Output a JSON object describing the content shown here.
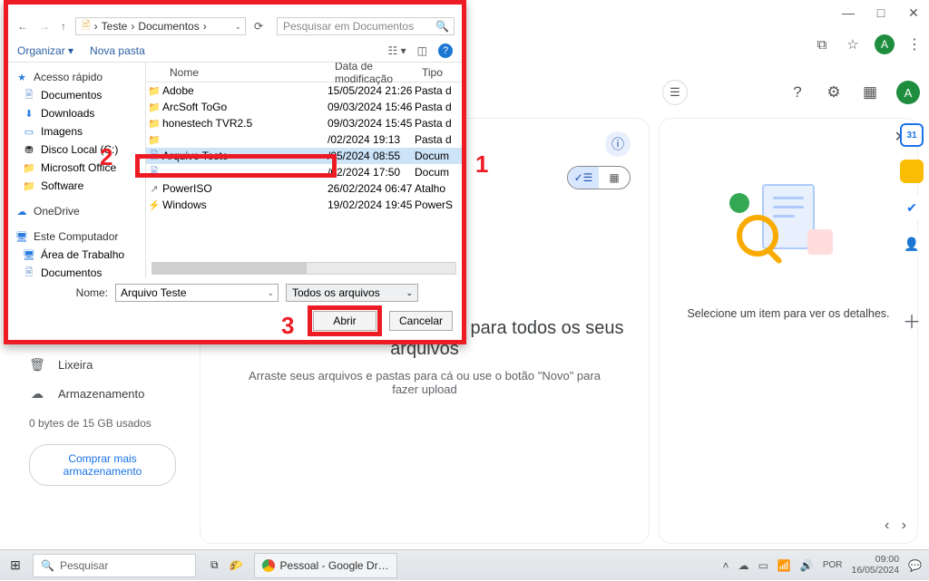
{
  "browser": {
    "avatar_initial": "A"
  },
  "drive": {
    "header_avatar": "A",
    "main_title": "Este é o Google Drive, o local para todos os seus arquivos",
    "main_sub": "Arraste seus arquivos e pastas para cá ou use o botão \"Novo\" para fazer upload",
    "detail_text": "Selecione um item para ver os detalhes.",
    "side": {
      "trash": "Lixeira",
      "storage": "Armazenamento",
      "usage": "0 bytes de 15 GB usados",
      "buy": "Comprar mais armazenamento"
    }
  },
  "dialog": {
    "path": {
      "root": "Teste",
      "folder": "Documentos"
    },
    "search_placeholder": "Pesquisar em Documentos",
    "toolbar": {
      "organize": "Organizar",
      "newfolder": "Nova pasta"
    },
    "columns": {
      "name": "Nome",
      "date": "Data de modificação",
      "type": "Tipo"
    },
    "tree": {
      "quick": "Acesso rápido",
      "items_quick": [
        "Documentos",
        "Downloads",
        "Imagens",
        "Disco Local (C:)",
        "Microsoft Office",
        "Software"
      ],
      "onedrive": "OneDrive",
      "thispc": "Este Computador",
      "items_pc": [
        "Área de Trabalho",
        "Documentos"
      ]
    },
    "files": [
      {
        "icon": "folder",
        "name": "Adobe",
        "date": "15/05/2024 21:26",
        "type": "Pasta d"
      },
      {
        "icon": "folder",
        "name": "ArcSoft ToGo",
        "date": "09/03/2024 15:46",
        "type": "Pasta d"
      },
      {
        "icon": "folder",
        "name": "honestech TVR2.5",
        "date": "09/03/2024 15:45",
        "type": "Pasta d"
      },
      {
        "icon": "folder",
        "name": "",
        "date": "/02/2024 19:13",
        "type": "Pasta d"
      },
      {
        "icon": "doc",
        "name": "Arquivo Teste",
        "date": "/05/2024 08:55",
        "type": "Docum",
        "selected": true
      },
      {
        "icon": "doc",
        "name": "",
        "date": "/02/2024 17:50",
        "type": "Docum"
      },
      {
        "icon": "lnk",
        "name": "PowerISO",
        "date": "26/02/2024 06:47",
        "type": "Atalho"
      },
      {
        "icon": "pwr",
        "name": "Windows",
        "date": "19/02/2024 19:45",
        "type": "PowerS"
      }
    ],
    "footer": {
      "name_label": "Nome:",
      "name_value": "Arquivo Teste",
      "filter": "Todos os arquivos",
      "open": "Abrir",
      "cancel": "Cancelar"
    }
  },
  "callouts": {
    "c1": "1",
    "c2": "2",
    "c3": "3"
  },
  "taskbar": {
    "search": "Pesquisar",
    "app": "Pessoal - Google Dr…",
    "time": "09:00",
    "date": "16/05/2024"
  },
  "addons": {
    "cal_day": "31"
  }
}
